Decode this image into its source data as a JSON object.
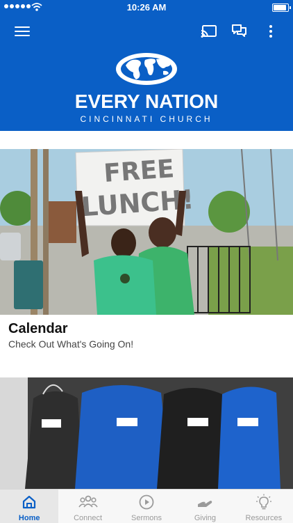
{
  "status_bar": {
    "time": "10:26 AM"
  },
  "header": {
    "brand_name": "EVERY NATION",
    "brand_subtitle": "CINCINNATI CHURCH",
    "colors": {
      "primary": "#0a5fc6"
    }
  },
  "cards": [
    {
      "title": "Calendar",
      "subtitle": "Check Out What's Going On!",
      "sign_text": "FREE LUNCH!"
    }
  ],
  "tabs": [
    {
      "label": "Home",
      "icon": "home-icon",
      "active": true
    },
    {
      "label": "Connect",
      "icon": "people-icon",
      "active": false
    },
    {
      "label": "Sermons",
      "icon": "play-icon",
      "active": false
    },
    {
      "label": "Giving",
      "icon": "hand-icon",
      "active": false
    },
    {
      "label": "Resources",
      "icon": "lightbulb-icon",
      "active": false
    }
  ]
}
